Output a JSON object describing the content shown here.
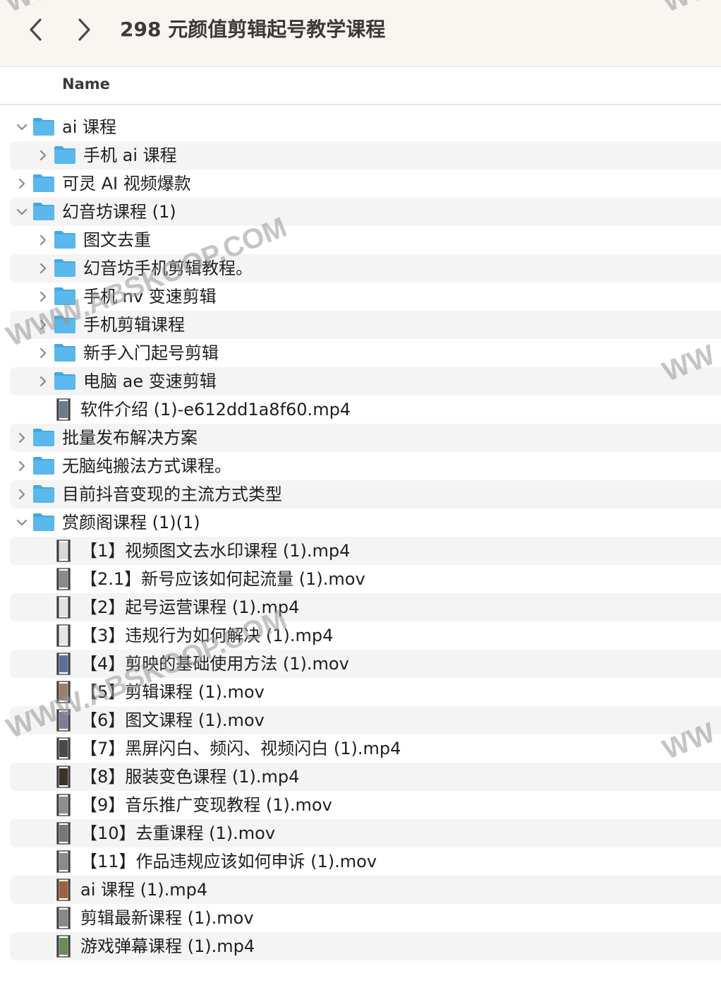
{
  "window": {
    "title": "298 元颜值剪辑起号教学课程"
  },
  "column_header": {
    "name": "Name"
  },
  "colors": {
    "folder": "#5ab8ec",
    "folder_tab": "#47a8e0",
    "row_alt": "#f4f4f4",
    "toolbar_bg": "#f9f5f1"
  },
  "items": [
    {
      "label": "ai 课程",
      "type": "folder",
      "depth": 0,
      "expanded": true
    },
    {
      "label": "手机 ai 课程",
      "type": "folder",
      "depth": 1,
      "expanded": false
    },
    {
      "label": "可灵 AI 视频爆款",
      "type": "folder",
      "depth": 0,
      "expanded": false
    },
    {
      "label": "幻音坊课程 (1)",
      "type": "folder",
      "depth": 0,
      "expanded": true
    },
    {
      "label": "图文去重",
      "type": "folder",
      "depth": 1,
      "expanded": false
    },
    {
      "label": "幻音坊手机剪辑教程。",
      "type": "folder",
      "depth": 1,
      "expanded": false
    },
    {
      "label": "手机 nv 变速剪辑",
      "type": "folder",
      "depth": 1,
      "expanded": false
    },
    {
      "label": "手机剪辑课程",
      "type": "folder",
      "depth": 1,
      "expanded": false
    },
    {
      "label": "新手入门起号剪辑",
      "type": "folder",
      "depth": 1,
      "expanded": false
    },
    {
      "label": "电脑 ae 变速剪辑",
      "type": "folder",
      "depth": 1,
      "expanded": false
    },
    {
      "label": "软件介绍 (1)-e612dd1a8f60.mp4",
      "type": "file",
      "depth": 1,
      "thumb": "#6b7a8c"
    },
    {
      "label": "批量发布解决方案",
      "type": "folder",
      "depth": 0,
      "expanded": false
    },
    {
      "label": "无脑纯搬法方式课程。",
      "type": "folder",
      "depth": 0,
      "expanded": false
    },
    {
      "label": "目前抖音变现的主流方式类型",
      "type": "folder",
      "depth": 0,
      "expanded": false
    },
    {
      "label": "赏颜阁课程 (1)(1)",
      "type": "folder",
      "depth": 0,
      "expanded": true
    },
    {
      "label": "【1】视频图文去水印课程 (1).mp4",
      "type": "file",
      "depth": 1,
      "thumb": "#d8d8d8"
    },
    {
      "label": "【2.1】新号应该如何起流量 (1).mov",
      "type": "file",
      "depth": 1,
      "thumb": "#8a8a8a"
    },
    {
      "label": "【2】起号运营课程 (1).mp4",
      "type": "file",
      "depth": 1,
      "thumb": "#e0e0e0"
    },
    {
      "label": "【3】违规行为如何解决 (1).mp4",
      "type": "file",
      "depth": 1,
      "thumb": "#e4e4e4"
    },
    {
      "label": "【4】剪映的基础使用方法 (1).mov",
      "type": "file",
      "depth": 1,
      "thumb": "#5c6fa0"
    },
    {
      "label": "【5】剪辑课程 (1).mov",
      "type": "file",
      "depth": 1,
      "thumb": "#9a7f6e"
    },
    {
      "label": "【6】图文课程 (1).mov",
      "type": "file",
      "depth": 1,
      "thumb": "#7c7f96"
    },
    {
      "label": "【7】黑屏闪白、频闪、视频闪白 (1).mp4",
      "type": "file",
      "depth": 1,
      "thumb": "#4a4a4a"
    },
    {
      "label": "【8】服装变色课程 (1).mp4",
      "type": "file",
      "depth": 1,
      "thumb": "#3a3226"
    },
    {
      "label": "【9】音乐推广变现教程 (1).mov",
      "type": "file",
      "depth": 1,
      "thumb": "#8e8e8e"
    },
    {
      "label": "【10】去重课程 (1).mov",
      "type": "file",
      "depth": 1,
      "thumb": "#777777"
    },
    {
      "label": "【11】作品违规应该如何申诉 (1).mov",
      "type": "file",
      "depth": 1,
      "thumb": "#8b8b8b"
    },
    {
      "label": "ai 课程 (1).mp4",
      "type": "file",
      "depth": 1,
      "thumb": "#a0623a"
    },
    {
      "label": "剪辑最新课程 (1).mov",
      "type": "file",
      "depth": 1,
      "thumb": "#888888"
    },
    {
      "label": "游戏弹幕课程 (1).mp4",
      "type": "file",
      "depth": 1,
      "thumb": "#6d8b5a"
    }
  ],
  "watermarks": [
    {
      "text": "WWW.ABSKOOP.COM"
    },
    {
      "text": "WWW.ABSKOOP.COM"
    },
    {
      "text": "WW"
    },
    {
      "text": "WW"
    },
    {
      "text": "WW"
    },
    {
      "text": "WW"
    }
  ]
}
